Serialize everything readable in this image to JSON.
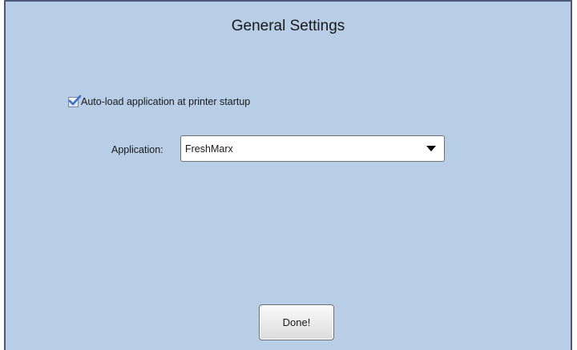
{
  "window": {
    "title": "General Settings"
  },
  "autoload": {
    "label": "Auto-load application at printer startup",
    "checked": true
  },
  "application": {
    "label": "Application:",
    "selected": "FreshMarx"
  },
  "footer": {
    "done_label": "Done!"
  },
  "colors": {
    "background": "#b8cde6",
    "checkmark": "#3a6fc4"
  },
  "icons": {
    "checkbox": "check-icon",
    "dropdown": "caret-down-icon"
  }
}
